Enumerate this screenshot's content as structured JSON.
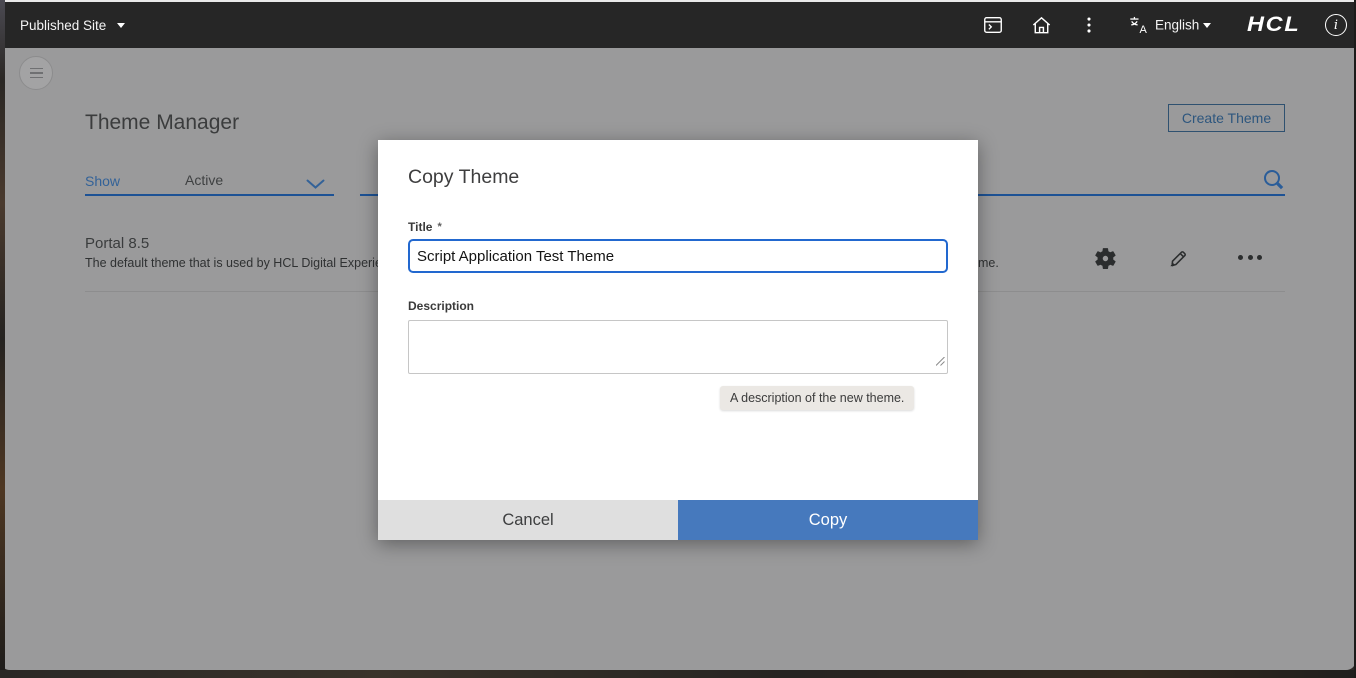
{
  "topbar": {
    "site_selector_label": "Published Site",
    "icons": [
      "site-preview-icon",
      "home-icon",
      "overflow-menu-icon",
      "language-icon",
      "info-icon"
    ],
    "language_label": "English",
    "logo_text": "HCL"
  },
  "page": {
    "title": "Theme Manager",
    "create_theme_button": "Create Theme",
    "filter": {
      "show_label": "Show",
      "selected_option": "Active"
    },
    "theme_row": {
      "name": "Portal 8.5",
      "description_visible_left": "The default theme that is used by HCL Digital Experien",
      "description_visible_right": "me.",
      "action_icons": [
        "settings-gear-icon",
        "edit-pencil-icon",
        "more-ellipsis-icon"
      ]
    }
  },
  "modal": {
    "title": "Copy Theme",
    "fields": {
      "title": {
        "label": "Title",
        "required_marker": "*",
        "value": "Script Application Test Theme"
      },
      "description": {
        "label": "Description",
        "value": "",
        "tooltip": "A description of the new theme."
      }
    },
    "buttons": {
      "cancel": "Cancel",
      "copy": "Copy"
    }
  },
  "colors": {
    "topbar_bg": "#262626",
    "dimmed_page_bg": "#9a9a9b",
    "filter_underline_blue": "#1d5295",
    "link_blue_dimmed": "#336298",
    "input_focus_border": "#2268cf",
    "copy_button_bg": "#4679bd",
    "cancel_button_bg": "#dfdfdf",
    "modal_bg": "#ffffff"
  }
}
